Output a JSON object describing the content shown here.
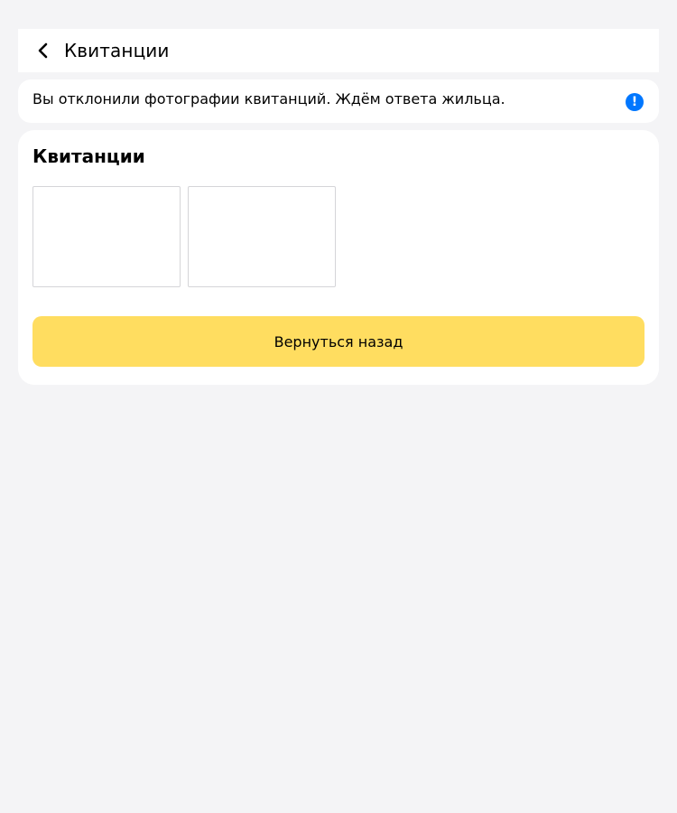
{
  "header": {
    "back_icon": "chevron-left-icon",
    "title": "Квитанции"
  },
  "notice": {
    "text": "Вы отклонили фотографии квитанций. Ждём ответа жильца.",
    "icon": "info-icon",
    "icon_glyph": "!",
    "icon_color": "#0077ff"
  },
  "receipts": {
    "title": "Квитанции",
    "thumbnails": [
      {
        "id": "receipt-1"
      },
      {
        "id": "receipt-2"
      }
    ]
  },
  "actions": {
    "back_label": "Вернуться назад",
    "accent_color": "#ffdd60"
  }
}
